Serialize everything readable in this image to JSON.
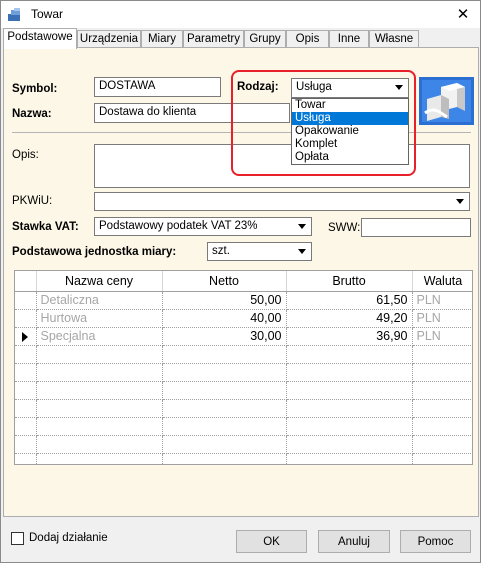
{
  "window": {
    "title": "Towar",
    "close_glyph": "✕"
  },
  "tabs": [
    {
      "label": "Podstawowe",
      "active": true
    },
    {
      "label": "Urządzenia"
    },
    {
      "label": "Miary"
    },
    {
      "label": "Parametry"
    },
    {
      "label": "Grupy"
    },
    {
      "label": "Opis"
    },
    {
      "label": "Inne"
    },
    {
      "label": "Własne"
    }
  ],
  "form": {
    "symbol_label": "Symbol:",
    "symbol_value": "DOSTAWA",
    "nazwa_label": "Nazwa:",
    "nazwa_value": "Dostawa do klienta",
    "rodzaj_label": "Rodzaj:",
    "rodzaj_value": "Usługa",
    "rodzaj_options": [
      "Towar",
      "Usługa",
      "Opakowanie",
      "Komplet",
      "Opłata"
    ],
    "rodzaj_selected_index": 1,
    "opis_label": "Opis:",
    "opis_value": "",
    "pkwiu_label": "PKWiU:",
    "pkwiu_value": "",
    "vat_label": "Stawka VAT:",
    "vat_value": "Podstawowy podatek VAT 23%",
    "sww_label": "SWW:",
    "sww_value": "",
    "unit_label": "Podstawowa jednostka miary:",
    "unit_value": "szt."
  },
  "prices": {
    "headers": [
      "Nazwa ceny",
      "Netto",
      "Brutto",
      "Waluta"
    ],
    "rows": [
      {
        "name": "Detaliczna",
        "netto": "50,00",
        "brutto": "61,50",
        "waluta": "PLN",
        "current": false
      },
      {
        "name": "Hurtowa",
        "netto": "40,00",
        "brutto": "49,20",
        "waluta": "PLN",
        "current": false
      },
      {
        "name": "Specjalna",
        "netto": "30,00",
        "brutto": "36,90",
        "waluta": "PLN",
        "current": true
      }
    ],
    "empty_rows": 7
  },
  "footer": {
    "checkbox_label": "Dodaj działanie",
    "ok_label": "OK",
    "cancel_label": "Anuluj",
    "help_label": "Pomoc"
  },
  "colors": {
    "panel_bg": "#fdf7e8",
    "selection": "#0078d7",
    "highlight": "#e8202a"
  }
}
